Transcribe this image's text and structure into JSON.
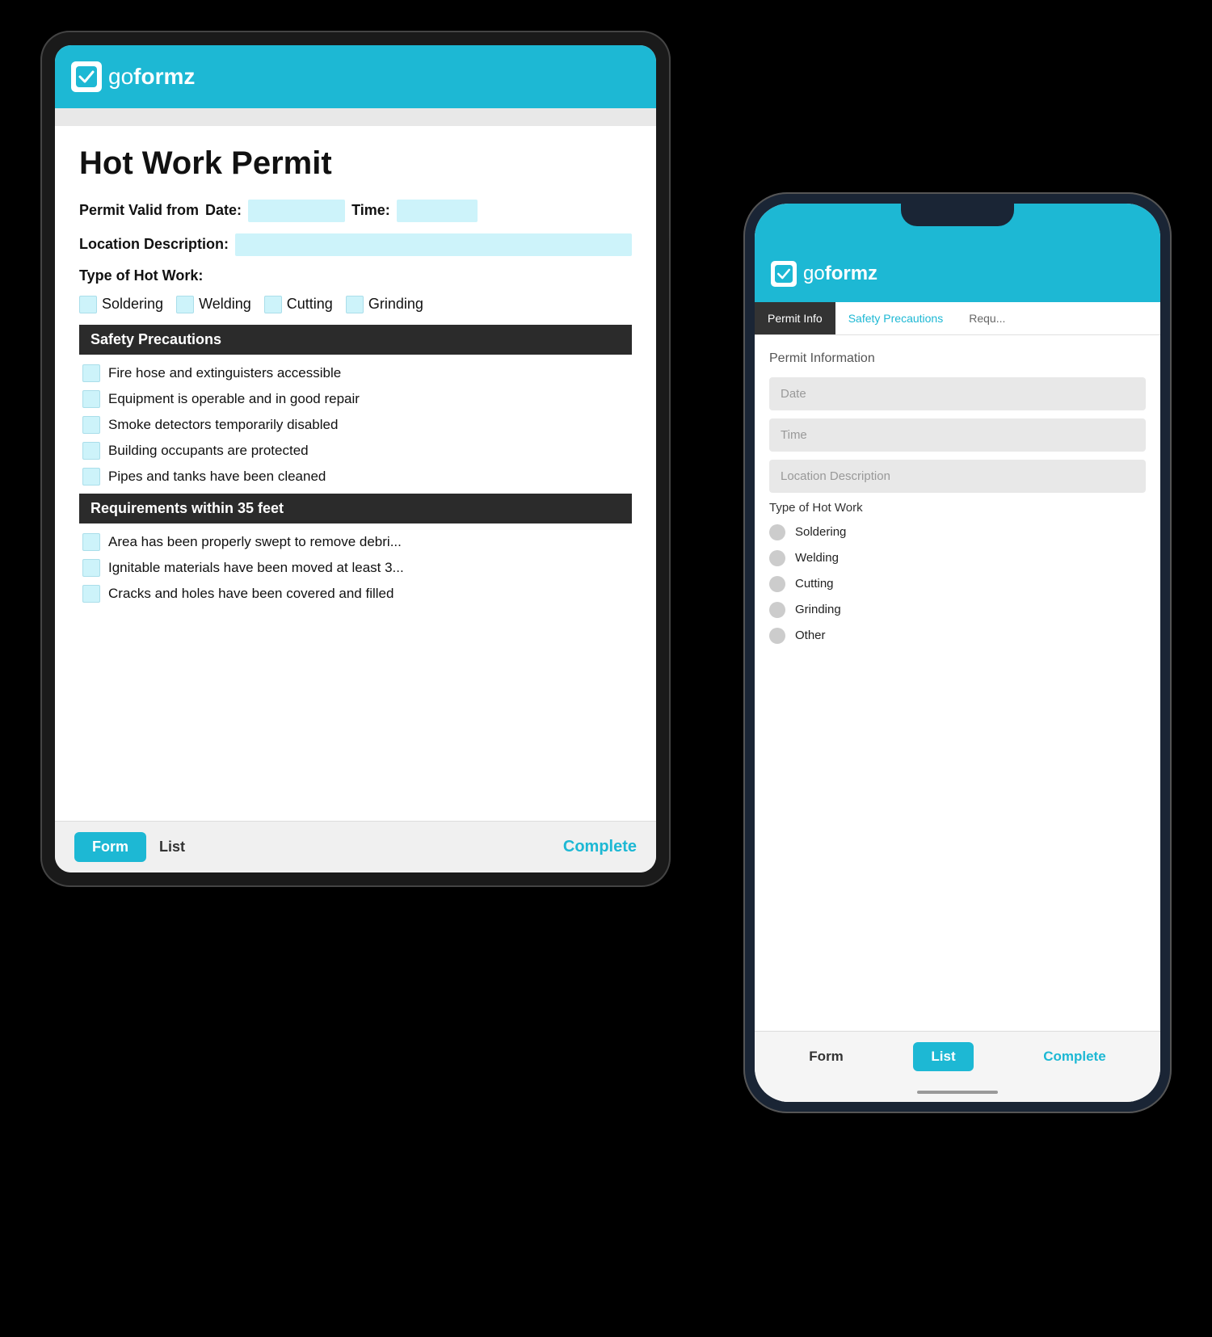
{
  "app": {
    "name": "goformz",
    "logo_alt": "GoFormz logo"
  },
  "tablet": {
    "form_title": "Hot Work Permit",
    "permit_label": "Permit Valid from",
    "date_label": "Date:",
    "time_label": "Time:",
    "location_label": "Location Description:",
    "hot_work_label": "Type of Hot Work:",
    "checkboxes": [
      "Soldering",
      "Welding",
      "Cutting",
      "Grinding"
    ],
    "section1": "Safety Precautions",
    "safety_items": [
      "Fire hose and extinguisters accessible",
      "Equipment is operable and in good repair",
      "Smoke detectors temporarily disabled",
      "Building occupants are protected",
      "Pipes and tanks have been cleaned"
    ],
    "section2": "Requirements within 35 feet",
    "req_items": [
      "Area has been properly swept to remove debri...",
      "Ignitable materials have been moved at least 3...",
      "Cracks and holes have been covered and filled"
    ],
    "footer": {
      "form_btn": "Form",
      "list_btn": "List",
      "complete_btn": "Complete"
    }
  },
  "phone": {
    "tabs": [
      {
        "label": "Permit Info",
        "state": "active"
      },
      {
        "label": "Safety Precautions",
        "state": "cyan"
      },
      {
        "label": "Requ...",
        "state": "gray"
      }
    ],
    "section_title": "Permit Information",
    "fields": [
      "Date",
      "Time",
      "Location Description"
    ],
    "hot_work_label": "Type of Hot Work",
    "radio_options": [
      "Soldering",
      "Welding",
      "Cutting",
      "Grinding",
      "Other"
    ],
    "footer": {
      "form_btn": "Form",
      "list_btn": "List",
      "complete_btn": "Complete"
    }
  }
}
